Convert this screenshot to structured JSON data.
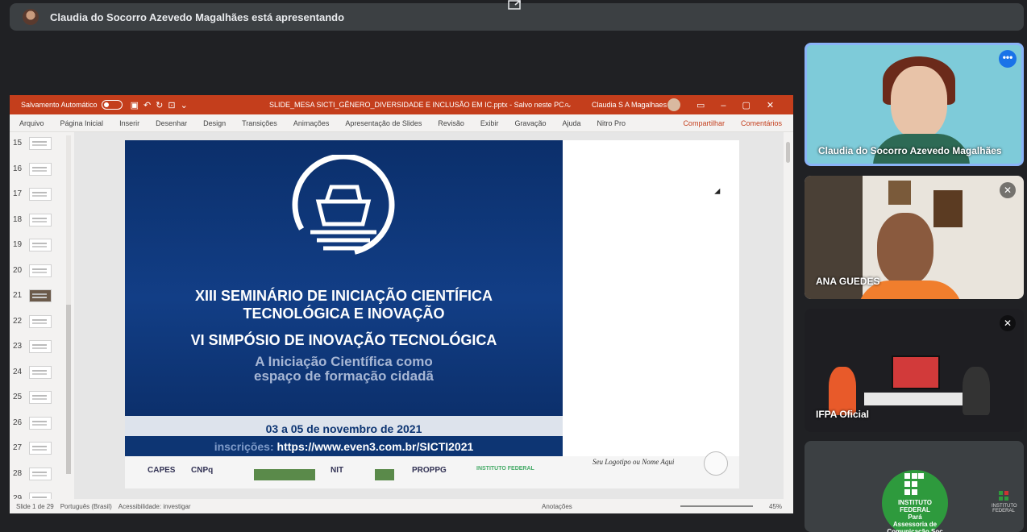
{
  "meet": {
    "presenting_banner": "Claudia do Socorro Azevedo Magalhães está apresentando"
  },
  "ppt": {
    "autosave_label": "Salvamento Automático",
    "file_name": "SLIDE_MESA SICTI_GÊNERO_DIVERSIDADE E INCLUSÃO EM IC.pptx  -  Salvo neste PC ⌄",
    "user_name": "Claudia S A Magalhaes",
    "menu": [
      "Arquivo",
      "Página Inicial",
      "Inserir",
      "Desenhar",
      "Design",
      "Transições",
      "Animações",
      "Apresentação de Slides",
      "Revisão",
      "Exibir",
      "Gravação",
      "Ajuda",
      "Nitro Pro"
    ],
    "share_label": "Compartilhar",
    "comments_label": "Comentários",
    "thumbnails": [
      "15",
      "16",
      "17",
      "18",
      "19",
      "20",
      "21",
      "22",
      "23",
      "24",
      "25",
      "26",
      "27",
      "28",
      "29"
    ],
    "status": {
      "slide_info": "Slide 1 de 29",
      "language": "Português (Brasil)",
      "accessibility": "Acessibilidade: investigar",
      "notes": "Anotações",
      "zoom": "45%"
    }
  },
  "slide": {
    "title_line1": "XIII SEMINÁRIO DE INICIAÇÃO CIENTÍFICA",
    "title_line2": "TECNOLÓGICA E INOVAÇÃO",
    "title_line3": "VI SIMPÓSIO DE INOVAÇÃO TECNOLÓGICA",
    "subtitle_line1": "A Iniciação Científica como",
    "subtitle_line2": "espaço de formação cidadã",
    "dates": "03 a 05 de novembro de 2021",
    "inscricoes_label": "inscrições:",
    "inscricoes_url": "https://www.even3.com.br/SICTI2021",
    "logos": [
      "CAPES",
      "CNPq",
      "NIT",
      "PROPPG",
      "INSTITUTO FEDERAL"
    ],
    "placeholder_logo": "Seu Logotipo ou Nome Aqui"
  },
  "participants": [
    {
      "name": "Claudia do Socorro Azevedo Magalhães"
    },
    {
      "name": "ANA GUEDES"
    },
    {
      "name": "IFPA Oficial"
    },
    {
      "name": "INSTITUTO FEDERAL",
      "sub": "Pará",
      "extra": "Assessoria de Comunicação Soc"
    }
  ],
  "colors": {
    "meet_bg": "#202124",
    "ppt_accent": "#c43e1c",
    "slide_blue": "#123e86",
    "active_border": "#8ab4f8",
    "ifpa_green": "#2e9a3d"
  }
}
